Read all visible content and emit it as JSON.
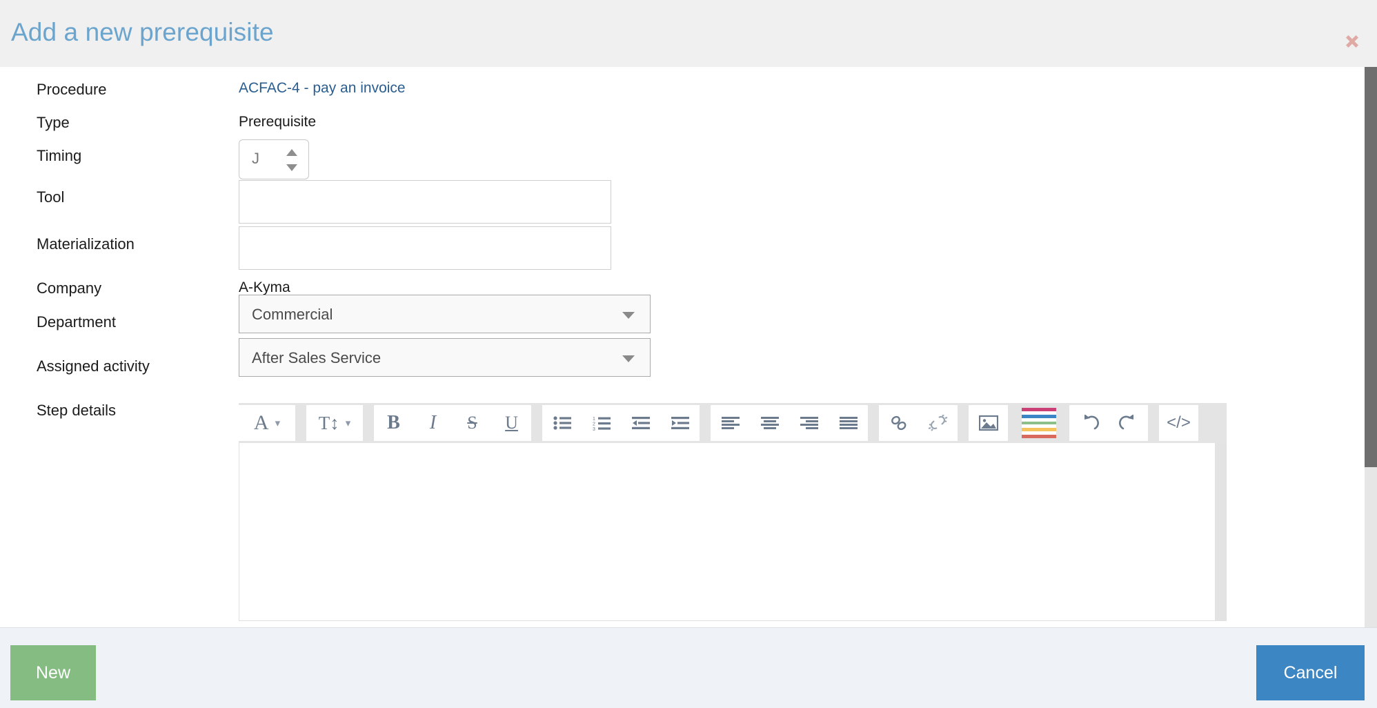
{
  "header": {
    "title": "Add a new prerequisite",
    "close_icon": "close-icon",
    "close_color": "#e0aaa4",
    "background": "#f0f0f0",
    "title_color": "#6ba4cd"
  },
  "form": {
    "rows": [
      {
        "label": "Procedure",
        "value": "ACFAC-4 - pay an invoice",
        "kind": "link"
      },
      {
        "label": "Type",
        "value": "Prerequisite",
        "kind": "text"
      },
      {
        "label": "Timing",
        "value": "J",
        "kind": "spinner"
      },
      {
        "label": "Tool",
        "value": "",
        "kind": "multiselect"
      },
      {
        "label": "Materialization",
        "value": "",
        "kind": "multiselect"
      },
      {
        "label": "Company",
        "value": "A-Kyma",
        "kind": "text"
      },
      {
        "label": "Department",
        "value": "Commercial",
        "kind": "select"
      },
      {
        "label": "Assigned activity",
        "value": "After Sales Service",
        "kind": "select"
      },
      {
        "label": "Step details",
        "value": "",
        "kind": "editor"
      }
    ],
    "link_color": "#2a5d8f"
  },
  "editor": {
    "content": "",
    "toolbar": [
      {
        "name": "font-family-button",
        "glyph": "A",
        "chevron": true
      },
      {
        "name": "font-size-button",
        "glyph": "T",
        "chevron": true
      },
      {
        "name": "bold-button",
        "glyph": "B",
        "chevron": false
      },
      {
        "name": "italic-button",
        "glyph": "I",
        "chevron": false
      },
      {
        "name": "strikethrough-button",
        "glyph": "S",
        "chevron": false
      },
      {
        "name": "underline-button",
        "glyph": "U",
        "chevron": false
      },
      {
        "name": "bullet-list-button",
        "glyph": "",
        "chevron": false
      },
      {
        "name": "numbered-list-button",
        "glyph": "",
        "chevron": false
      },
      {
        "name": "outdent-button",
        "glyph": "",
        "chevron": false
      },
      {
        "name": "indent-button",
        "glyph": "",
        "chevron": false
      },
      {
        "name": "align-left-button",
        "glyph": "",
        "chevron": false
      },
      {
        "name": "align-center-button",
        "glyph": "",
        "chevron": false
      },
      {
        "name": "align-right-button",
        "glyph": "",
        "chevron": false
      },
      {
        "name": "align-justify-button",
        "glyph": "",
        "chevron": false
      },
      {
        "name": "link-button",
        "glyph": "",
        "chevron": false
      },
      {
        "name": "unlink-button",
        "glyph": "",
        "chevron": false
      },
      {
        "name": "insert-image-button",
        "glyph": "",
        "chevron": false
      },
      {
        "name": "text-color-button",
        "glyph": "",
        "chevron": false
      },
      {
        "name": "undo-button",
        "glyph": "",
        "chevron": false
      },
      {
        "name": "redo-button",
        "glyph": "",
        "chevron": false
      },
      {
        "name": "code-view-button",
        "glyph": "",
        "chevron": false
      }
    ],
    "palette_colors": [
      "#cc4078",
      "#3b85c6",
      "#8dbf8a",
      "#f6c45c",
      "#d9695c"
    ]
  },
  "footer": {
    "new_label": "New",
    "cancel_label": "Cancel",
    "new_color": "#85bc82",
    "cancel_color": "#3d86c4"
  }
}
